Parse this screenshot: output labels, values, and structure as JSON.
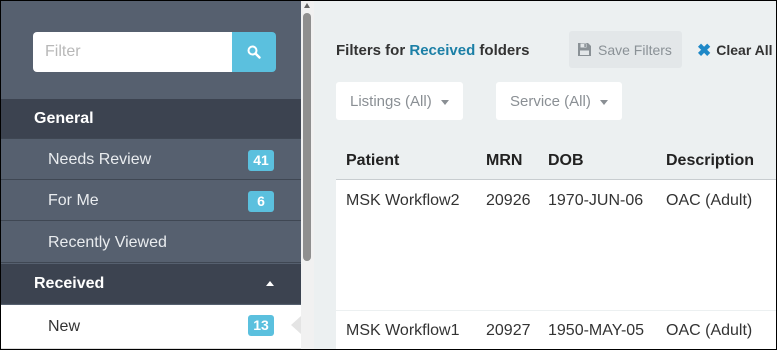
{
  "sidebar": {
    "filter_placeholder": "Filter",
    "search_icon": "search-icon",
    "sections": [
      {
        "label": "General",
        "items": [
          {
            "label": "Needs Review",
            "count": "41"
          },
          {
            "label": "For Me",
            "count": "6"
          },
          {
            "label": "Recently Viewed",
            "count": null
          }
        ]
      },
      {
        "label": "Received",
        "expanded": true,
        "items": [
          {
            "label": "New",
            "count": "13",
            "active": true
          }
        ]
      }
    ]
  },
  "filters": {
    "title_prefix": "Filters for",
    "title_folder": "Received",
    "title_suffix": "folders",
    "save_label": "Save Filters",
    "clear_label": "Clear All",
    "dropdowns": [
      {
        "label": "Listings (All)"
      },
      {
        "label": "Service (All)"
      }
    ]
  },
  "table": {
    "columns": [
      "Patient",
      "MRN",
      "DOB",
      "Description"
    ],
    "rows": [
      {
        "patient": "MSK Workflow2",
        "mrn": "20926",
        "dob": "1970-JUN-06",
        "description": "OAC (Adult)"
      },
      {
        "patient": "MSK Workflow1",
        "mrn": "20927",
        "dob": "1950-MAY-05",
        "description": "OAC (Adult)"
      }
    ]
  },
  "colors": {
    "sidebar_bg": "#56606f",
    "sidebar_header_bg": "#3c4350",
    "badge": "#5bc0de",
    "accent": "#1b7fa6",
    "main_bg": "#ecf0f1"
  }
}
